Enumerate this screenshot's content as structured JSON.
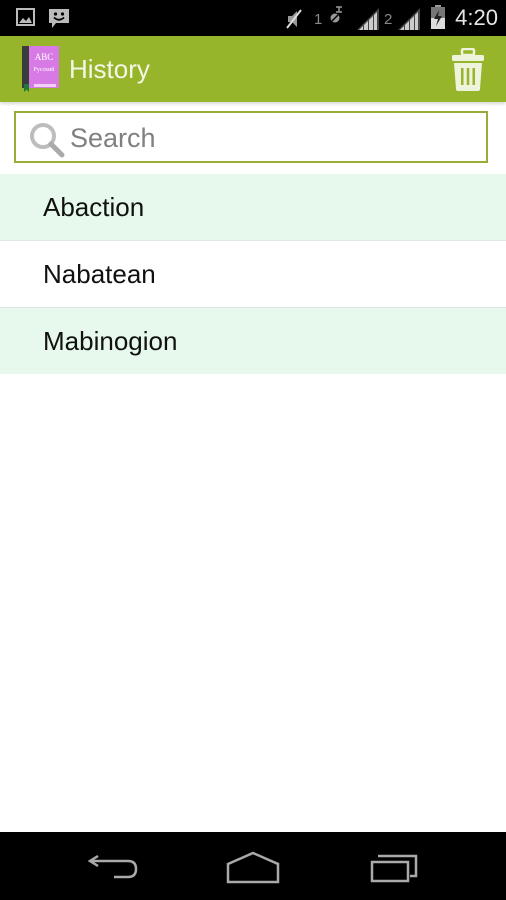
{
  "status_bar": {
    "time": "4:20",
    "sim1_label": "1",
    "sim2_label": "2",
    "icons": [
      "image-notification-icon",
      "chat-notification-icon",
      "muted-icon",
      "data-icon",
      "signal-icon",
      "signal-icon",
      "battery-charging-icon"
    ]
  },
  "action_bar": {
    "title": "History",
    "app_icon_text_top": "ABC",
    "app_icon_text_bottom": "Русский",
    "action_icon": "trash-icon"
  },
  "search": {
    "placeholder": "Search",
    "value": ""
  },
  "history": {
    "items": [
      {
        "label": "Abaction"
      },
      {
        "label": "Nabatean"
      },
      {
        "label": "Mabinogion"
      }
    ]
  },
  "nav_bar": {
    "buttons": [
      "back",
      "home",
      "recents"
    ]
  },
  "colors": {
    "accent": "#97b52b",
    "row_highlight": "#e7f9ec",
    "search_border": "#9aab3a"
  }
}
